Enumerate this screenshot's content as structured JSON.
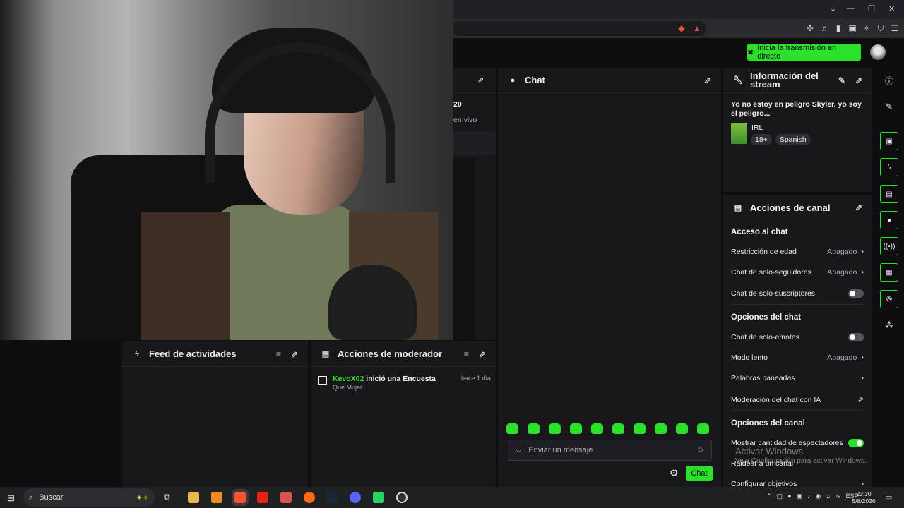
{
  "header": {
    "go_live_label": "Inicia la transmisión en directo"
  },
  "partial": {
    "line1": "20",
    "line2": "en vivo"
  },
  "chat": {
    "title": "Chat",
    "input_placeholder": "Enviar un mensaje",
    "send_label": "Chat"
  },
  "info": {
    "title": "Información del stream",
    "stream_title": "Yo no estoy en peligro Skyler, yo soy el peligro...",
    "category": "IRL",
    "tags": [
      "18+",
      "Spanish"
    ]
  },
  "actions": {
    "title": "Acciones de canal",
    "section_access": "Acceso al chat",
    "age_restriction": {
      "label": "Restricción de edad",
      "value": "Apagado"
    },
    "followers_only": {
      "label": "Chat de solo-seguidores",
      "value": "Apagado"
    },
    "subs_only": {
      "label": "Chat de solo-suscriptores"
    },
    "section_chat": "Opciones del chat",
    "emotes_only": {
      "label": "Chat de solo-emotes"
    },
    "slow_mode": {
      "label": "Modo lento",
      "value": "Apagado"
    },
    "banned_words": {
      "label": "Palabras baneadas"
    },
    "ai_moderation": {
      "label": "Moderación del chat con IA"
    },
    "section_channel": "Opciones del canal",
    "viewer_count": {
      "label": "Mostrar cantidad de espectadores"
    },
    "raid_channel": {
      "label": "Raidear a un canal"
    },
    "goals": {
      "label": "Configurar objetivos"
    }
  },
  "feed": {
    "title": "Feed de actividades"
  },
  "moderator": {
    "title": "Acciones de moderador",
    "entry": {
      "user": "KevoX02",
      "action": " inició una Encuesta",
      "time": "hace 1 día",
      "detail": "Que Mujer"
    }
  },
  "watermark": {
    "line1": "Activar Windows",
    "line2": "Ve a Configuración para activar Windows."
  },
  "taskbar": {
    "search_label": "Buscar",
    "lang": "ESP",
    "time": "23:30",
    "date": "5/8/2026"
  },
  "colors": {
    "accent": "#2be12b",
    "panel": "#18181b",
    "background": "#0e0e10"
  }
}
